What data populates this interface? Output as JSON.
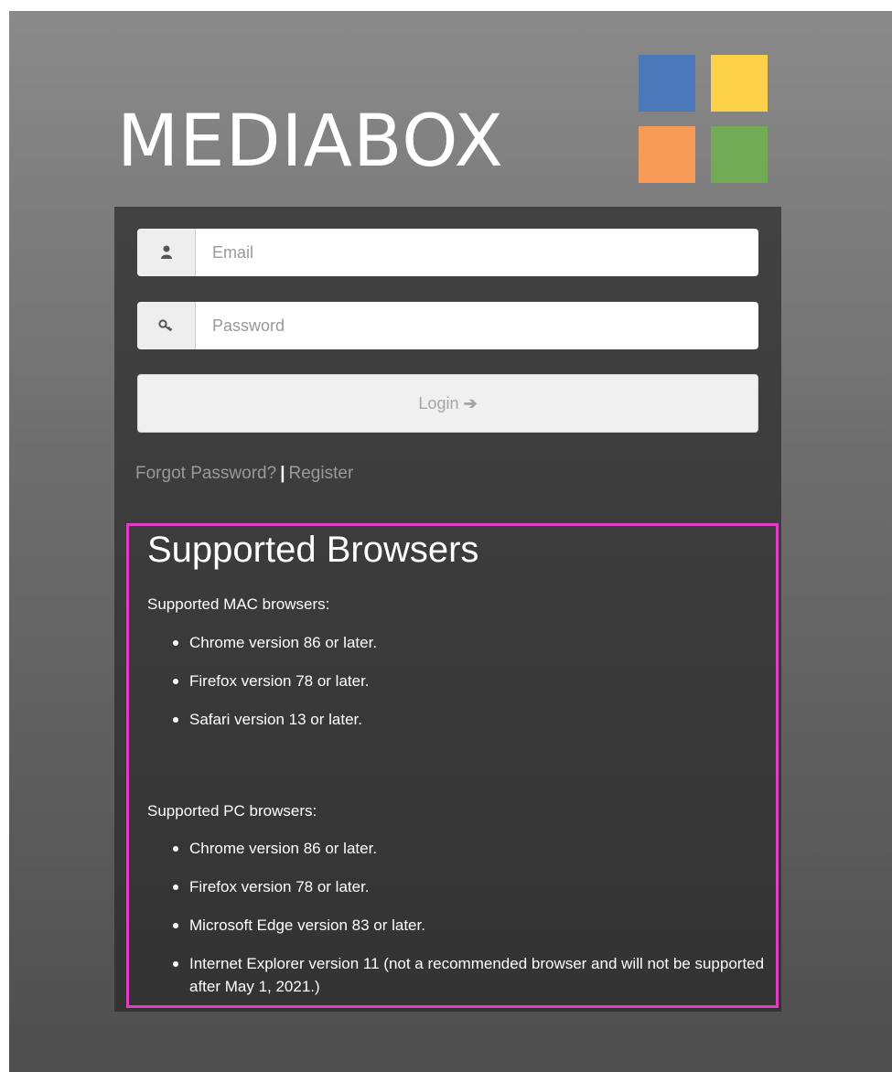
{
  "logo": {
    "text": "MEDIABOX",
    "colors": {
      "blue": "#4a78b8",
      "yellow": "#fdd24a",
      "orange": "#f59b56",
      "green": "#72aa55"
    }
  },
  "login": {
    "email_placeholder": "Email",
    "password_placeholder": "Password",
    "email_icon": "user-icon",
    "password_icon": "key-icon",
    "button_label": "Login",
    "button_icon": "arrow-right-icon",
    "forgot_label": "Forgot Password?",
    "separator": "|",
    "register_label": "Register"
  },
  "supported": {
    "title": "Supported Browsers",
    "mac_label": "Supported MAC browsers:",
    "mac_items": [
      "Chrome version 86 or later.",
      "Firefox version 78 or later.",
      "Safari version 13 or later."
    ],
    "pc_label": "Supported PC browsers:",
    "pc_items": [
      "Chrome version 86 or later.",
      "Firefox version 78 or later.",
      "Microsoft Edge version 83 or later.",
      "Internet Explorer version 11 (not a recommended browser and will not be supported after May 1, 2021.)"
    ],
    "highlight_color": "#e03ec4"
  }
}
